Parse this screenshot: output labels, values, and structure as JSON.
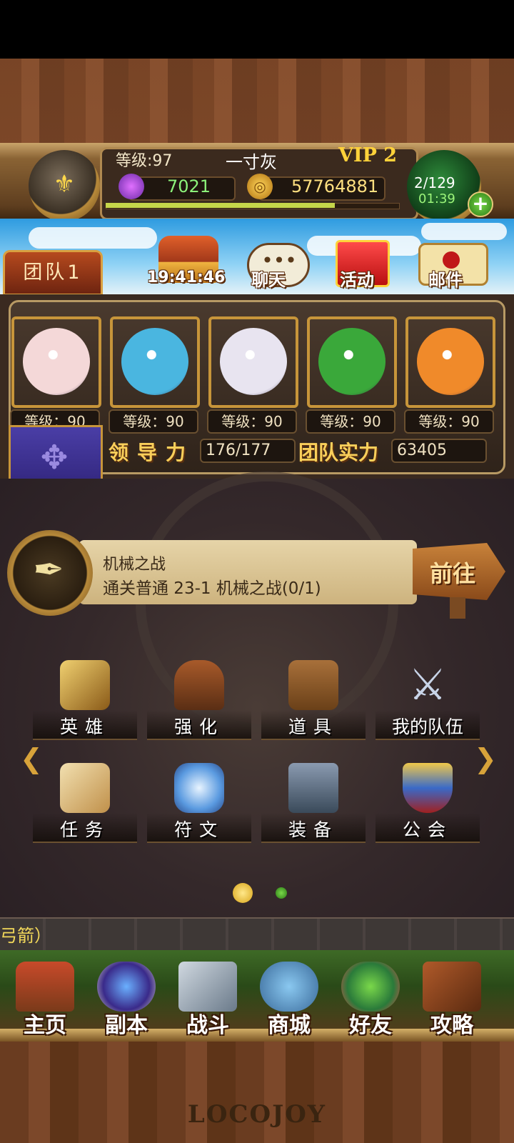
{
  "header": {
    "level_label": "等级:97",
    "player_name": "一寸灰",
    "vip": "VIP 2",
    "gems": "7021",
    "coins": "57764881",
    "stamina": "2/129",
    "stamina_timer": "01:39",
    "plus": "+",
    "coin_glyph": "◎",
    "exp_progress": 0.78
  },
  "topbar": {
    "team_tab": "团队1",
    "chest_timer": "19:41:46",
    "chat_label": "聊天",
    "chat_dots": "•••",
    "activity_label": "活动",
    "mail_label": "邮件"
  },
  "team": {
    "heroes": [
      {
        "level_label": "等级：90",
        "color": "#f4d8d8"
      },
      {
        "level_label": "等级：90",
        "color": "#4ab6e0"
      },
      {
        "level_label": "等级：90",
        "color": "#e8e4f0"
      },
      {
        "level_label": "等级：90",
        "color": "#3aa83a"
      },
      {
        "level_label": "等级：90",
        "color": "#f08a2a"
      }
    ],
    "leadership_label": "领导力",
    "leadership_value": "176/177",
    "power_label": "团队实力",
    "power_value": "63405",
    "banner_emblem": "✥"
  },
  "quest": {
    "title": "机械之战",
    "description": "通关普通 23-1 机械之战(0/1)",
    "go_label": "前往",
    "quill_icon": "✒"
  },
  "menu": {
    "row1": [
      "英雄",
      "强化",
      "道具",
      "我的队伍"
    ],
    "row2": [
      "任务",
      "符文",
      "装备",
      "公会"
    ],
    "arrow_left": "❮",
    "arrow_right": "❯"
  },
  "ticker": "弓箭）",
  "bottom_nav": [
    "主页",
    "副本",
    "战斗",
    "商城",
    "好友",
    "攻略"
  ],
  "brand": "LOCOJOY",
  "colors": {
    "gold": "#f9cf5a",
    "green_value": "#8cf27a",
    "gold_value": "#ffe080"
  }
}
